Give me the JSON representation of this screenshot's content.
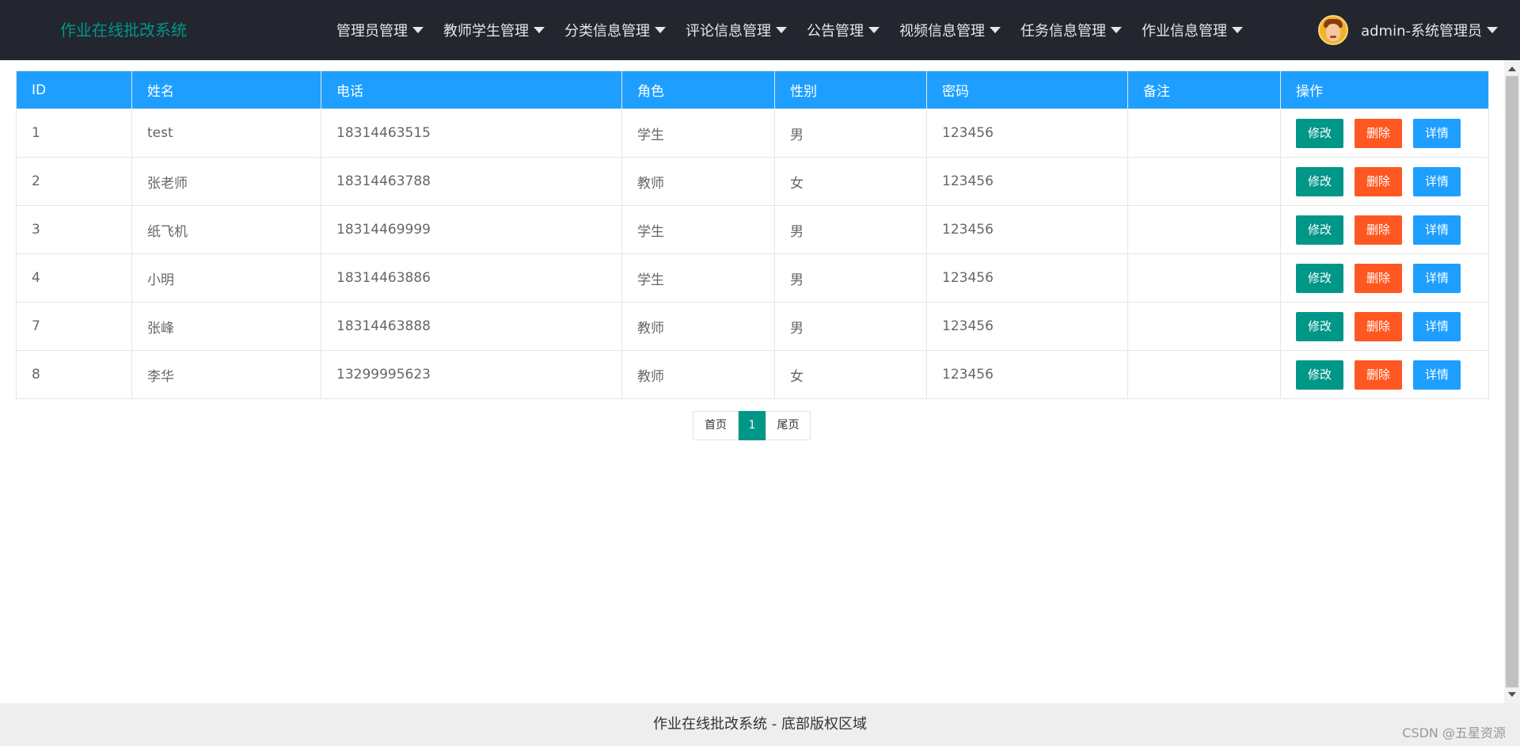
{
  "header": {
    "brand": "作业在线批改系统",
    "nav": [
      {
        "label": "管理员管理"
      },
      {
        "label": "教师学生管理"
      },
      {
        "label": "分类信息管理"
      },
      {
        "label": "评论信息管理"
      },
      {
        "label": "公告管理"
      },
      {
        "label": "视频信息管理"
      },
      {
        "label": "任务信息管理"
      },
      {
        "label": "作业信息管理"
      }
    ],
    "user": "admin-系统管理员"
  },
  "table": {
    "columns": [
      "ID",
      "姓名",
      "电话",
      "角色",
      "性别",
      "密码",
      "备注",
      "操作"
    ],
    "rows": [
      {
        "id": "1",
        "name": "test",
        "phone": "18314463515",
        "role": "学生",
        "gender": "男",
        "password": "123456",
        "remark": ""
      },
      {
        "id": "2",
        "name": "张老师",
        "phone": "18314463788",
        "role": "教师",
        "gender": "女",
        "password": "123456",
        "remark": ""
      },
      {
        "id": "3",
        "name": "纸飞机",
        "phone": "18314469999",
        "role": "学生",
        "gender": "男",
        "password": "123456",
        "remark": ""
      },
      {
        "id": "4",
        "name": "小明",
        "phone": "18314463886",
        "role": "学生",
        "gender": "男",
        "password": "123456",
        "remark": ""
      },
      {
        "id": "7",
        "name": "张峰",
        "phone": "18314463888",
        "role": "教师",
        "gender": "男",
        "password": "123456",
        "remark": ""
      },
      {
        "id": "8",
        "name": "李华",
        "phone": "13299995623",
        "role": "教师",
        "gender": "女",
        "password": "123456",
        "remark": ""
      }
    ],
    "actions": {
      "edit": "修改",
      "delete": "删除",
      "detail": "详情"
    }
  },
  "pagination": {
    "first": "首页",
    "current": "1",
    "last": "尾页"
  },
  "footer": {
    "text": "作业在线批改系统 - 底部版权区域"
  },
  "watermark": "CSDN @五星资源",
  "colors": {
    "header_bg": "#23262e",
    "brand": "#009688",
    "table_header": "#1e9fff",
    "edit": "#009688",
    "delete": "#ff5722",
    "detail": "#1e9fff"
  }
}
